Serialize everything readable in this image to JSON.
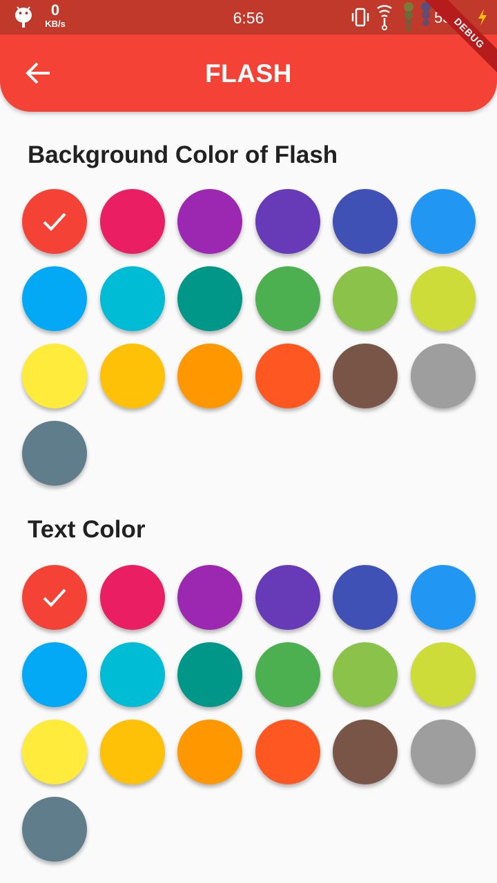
{
  "status_bar": {
    "net_speed_value": "0",
    "net_speed_unit": "KB/s",
    "time": "6:56",
    "battery": "53"
  },
  "app_bar": {
    "title": "FLASH",
    "debug_label": "DEBUG"
  },
  "sections": [
    {
      "title": "Background Color of Flash",
      "selected_index": 0,
      "colors": [
        "#f44336",
        "#e91e63",
        "#9c27b0",
        "#673ab7",
        "#3f51b5",
        "#2196f3",
        "#03a9f4",
        "#00bcd4",
        "#009688",
        "#4caf50",
        "#8bc34a",
        "#cddc39",
        "#ffeb3b",
        "#ffc107",
        "#ff9800",
        "#ff5722",
        "#795548",
        "#9e9e9e",
        "#607d8b"
      ]
    },
    {
      "title": "Text Color",
      "selected_index": 0,
      "colors": [
        "#f44336",
        "#e91e63",
        "#9c27b0",
        "#673ab7",
        "#3f51b5",
        "#2196f3",
        "#03a9f4",
        "#00bcd4",
        "#009688",
        "#4caf50",
        "#8bc34a",
        "#cddc39",
        "#ffeb3b",
        "#ffc107",
        "#ff9800",
        "#ff5722",
        "#795548",
        "#9e9e9e",
        "#607d8b"
      ]
    }
  ]
}
